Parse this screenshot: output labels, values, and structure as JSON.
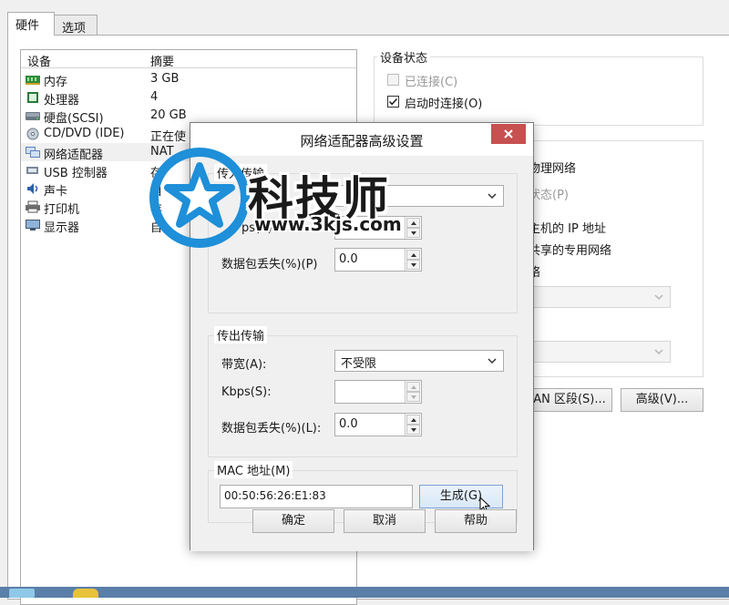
{
  "tabs": [
    {
      "label": "硬件"
    },
    {
      "label": "选项"
    }
  ],
  "devices": {
    "header": {
      "device": "设备",
      "summary": "摘要"
    },
    "items": [
      {
        "name": "内存",
        "summary": "3 GB",
        "icon": "memory-icon"
      },
      {
        "name": "处理器",
        "summary": "4",
        "icon": "processor-icon"
      },
      {
        "name": "硬盘(SCSI)",
        "summary": "20 GB",
        "icon": "hard-disk-icon"
      },
      {
        "name": "CD/DVD (IDE)",
        "summary": "正在使",
        "icon": "cd-dvd-icon"
      },
      {
        "name": "网络适配器",
        "summary": "NAT",
        "icon": "network-adapter-icon"
      },
      {
        "name": "USB 控制器",
        "summary": "存",
        "icon": "usb-icon"
      },
      {
        "name": "声卡",
        "summary": "自",
        "icon": "sound-card-icon"
      },
      {
        "name": "打印机",
        "summary": "存",
        "icon": "printer-icon"
      },
      {
        "name": "显示器",
        "summary": "自",
        "icon": "display-icon"
      }
    ]
  },
  "device_status": {
    "title": "设备状态",
    "connected": "已连接(C)",
    "connected_checked": false,
    "connect_at_power_on": "启动时连接(O)",
    "connect_at_power_on_checked": true
  },
  "network_connection": {
    "bridged_fragment": "物理网络",
    "replicate_fragment": "状态(P)",
    "nat_fragment": "主机的 IP 地址",
    "hostonly_fragment": "共享的专用网络",
    "custom_fragment": "络",
    "lan_segments_button": "AN 区段(S)...",
    "advanced_button": "高级(V)..."
  },
  "dialog": {
    "title": "网络适配器高级设置",
    "incoming": {
      "title": "传入传输",
      "kbps_label": "ps(K):",
      "kbps_value": "",
      "loss_label": "数据包丢失(%)(P)",
      "loss_value": "0.0"
    },
    "outgoing": {
      "title": "传出传输",
      "bandwidth_label": "带宽(A):",
      "bandwidth_value": "不受限",
      "kbps_label": "Kbps(S):",
      "kbps_value": "",
      "loss_label": "数据包丢失(%)(L):",
      "loss_value": "0.0"
    },
    "mac": {
      "title": "MAC 地址(M)",
      "value": "00:50:56:26:E1:83",
      "generate_button": "生成(G)"
    },
    "buttons": {
      "ok": "确定",
      "cancel": "取消",
      "help": "帮助"
    }
  },
  "watermark": {
    "brand": "科技师",
    "url": "www.3kjs.com"
  },
  "colors": {
    "close_button": "#c75050",
    "watermark_blue": "#1e8fd8"
  }
}
